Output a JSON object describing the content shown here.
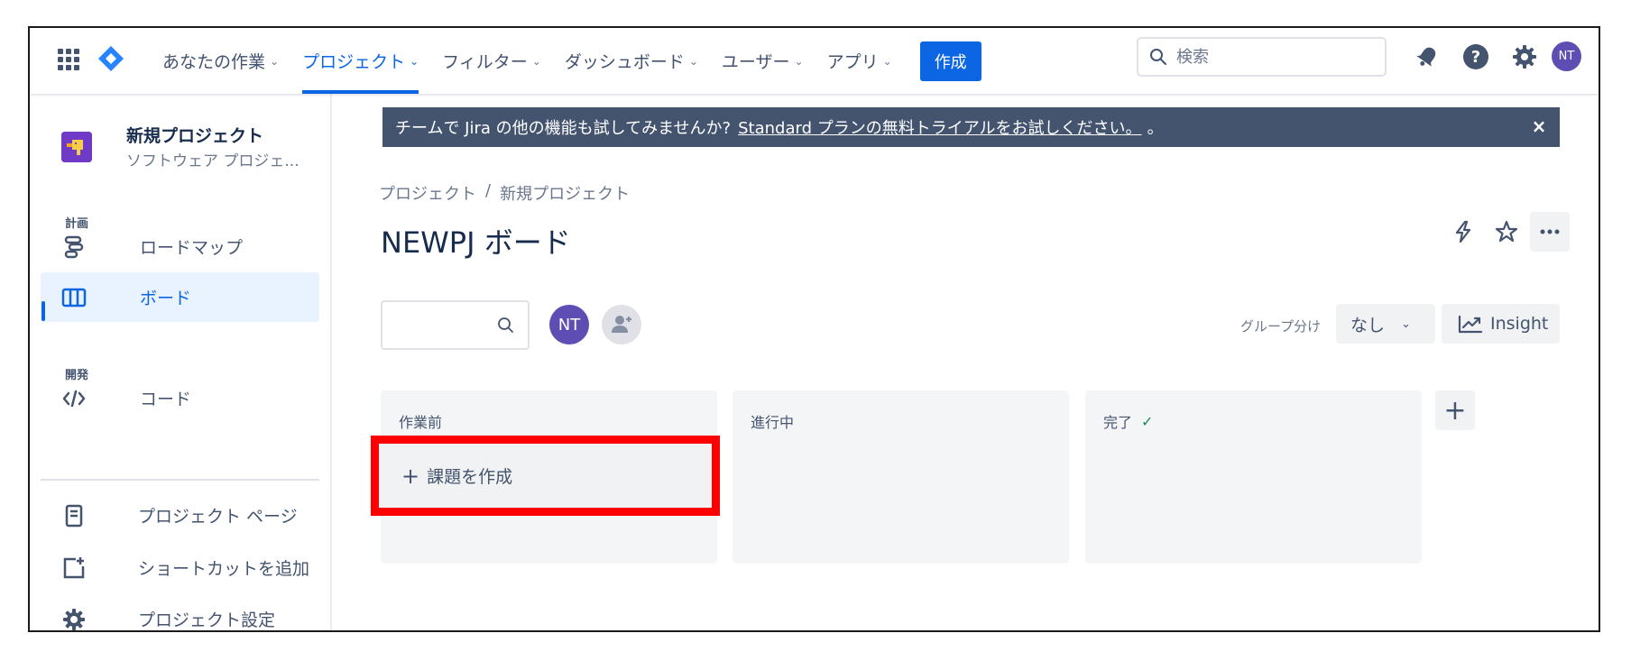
{
  "nav": {
    "items": [
      {
        "label": "あなたの作業"
      },
      {
        "label": "プロジェクト"
      },
      {
        "label": "フィルター"
      },
      {
        "label": "ダッシュボード"
      },
      {
        "label": "ユーザー"
      },
      {
        "label": "アプリ"
      }
    ],
    "active_index": 1,
    "create_label": "作成",
    "search_placeholder": "検索",
    "avatar_initials": "NT",
    "accent_color": "#0c66e4"
  },
  "sidebar": {
    "project_name": "新規プロジェクト",
    "project_type": "ソフトウェア プロジェ...",
    "sections": {
      "plan": "計画",
      "dev": "開発"
    },
    "items": [
      {
        "label": "ロードマップ",
        "icon": "roadmap-icon"
      },
      {
        "label": "ボード",
        "icon": "board-icon",
        "active": true
      },
      {
        "label": "コード",
        "icon": "code-icon"
      },
      {
        "label": "プロジェクト ページ",
        "icon": "page-icon"
      },
      {
        "label": "ショートカットを追加",
        "icon": "add-shortcut-icon"
      },
      {
        "label": "プロジェクト設定",
        "icon": "settings-icon"
      }
    ]
  },
  "banner": {
    "text": "チームで Jira の他の機能も試してみませんか?",
    "link": "Standard プランの無料トライアルをお試しください。",
    "suffix": "。",
    "close": "×",
    "color": "#44546f"
  },
  "breadcrumb": {
    "root": "プロジェクト",
    "separator": "/",
    "current": "新規プロジェクト"
  },
  "page": {
    "title": "NEWPJ ボード"
  },
  "toolbar": {
    "avatar_initials": "NT",
    "group_label": "グループ分け",
    "group_value": "なし",
    "insight_label": "Insight"
  },
  "board": {
    "columns": [
      {
        "title": "作業前"
      },
      {
        "title": "進行中"
      },
      {
        "title": "完了",
        "done": true
      }
    ],
    "create_issue_label": "課題を作成",
    "add_column": "+",
    "highlight_color": "#ff0000"
  }
}
